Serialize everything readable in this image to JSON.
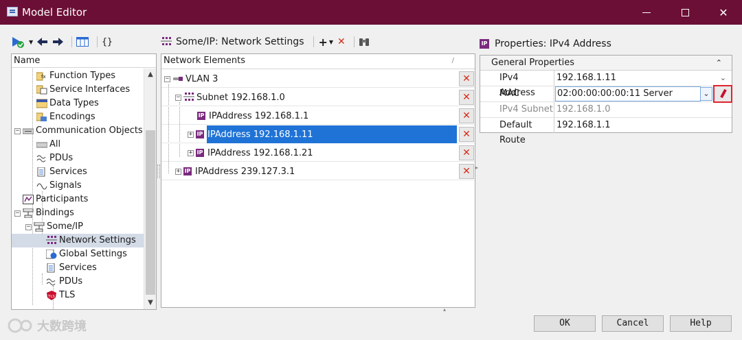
{
  "window": {
    "title": "Model Editor"
  },
  "left": {
    "column_header": "Name",
    "tree": [
      {
        "label": "Function Types",
        "icon": "function-types-icon"
      },
      {
        "label": "Service Interfaces",
        "icon": "service-interfaces-icon"
      },
      {
        "label": "Data Types",
        "icon": "data-types-icon"
      },
      {
        "label": "Encodings",
        "icon": "encodings-icon"
      },
      {
        "label": "Communication Objects",
        "icon": "communication-objects-icon"
      },
      {
        "label": "All",
        "icon": "all-icon"
      },
      {
        "label": "PDUs",
        "icon": "pdus-icon"
      },
      {
        "label": "Services",
        "icon": "services-icon"
      },
      {
        "label": "Signals",
        "icon": "signals-icon"
      },
      {
        "label": "Participants",
        "icon": "participants-icon"
      },
      {
        "label": "Bindings",
        "icon": "bindings-icon"
      },
      {
        "label": "Some/IP",
        "icon": "someip-icon"
      },
      {
        "label": "Network Settings",
        "icon": "network-settings-icon"
      },
      {
        "label": "Global Settings",
        "icon": "global-settings-icon"
      },
      {
        "label": "Services",
        "icon": "services-icon"
      },
      {
        "label": "PDUs",
        "icon": "pdus-icon"
      },
      {
        "label": "TLS",
        "icon": "tls-icon"
      }
    ]
  },
  "middle": {
    "title": "Some/IP: Network Settings",
    "column_header": "Network Elements",
    "rows": [
      {
        "label": "VLAN 3"
      },
      {
        "label": "Subnet 192.168.1.0"
      },
      {
        "label": "IPAddress 192.168.1.1"
      },
      {
        "label": "IPAddress 192.168.1.11"
      },
      {
        "label": "IPAddress 192.168.1.21"
      },
      {
        "label": "IPAddress 239.127.3.1"
      }
    ],
    "delete_glyph": "✕"
  },
  "right": {
    "title": "Properties: IPv4 Address",
    "group": "General Properties",
    "properties": [
      {
        "name": "IPv4 Address",
        "value": "192.168.1.11"
      },
      {
        "name": "MAC",
        "value": "02:00:00:00:00:11 Server"
      },
      {
        "name": "IPv4 Subnet",
        "value": "192.168.1.0"
      },
      {
        "name": "Default Route",
        "value": "192.168.1.1"
      }
    ]
  },
  "buttons": {
    "ok": "OK",
    "cancel": "Cancel",
    "help": "Help"
  },
  "watermark": "大数跨境",
  "colors": {
    "titlebar": "#6b0f36",
    "selection": "#1f73d6",
    "delete": "#d62b16",
    "highlight": "#e0242c"
  }
}
